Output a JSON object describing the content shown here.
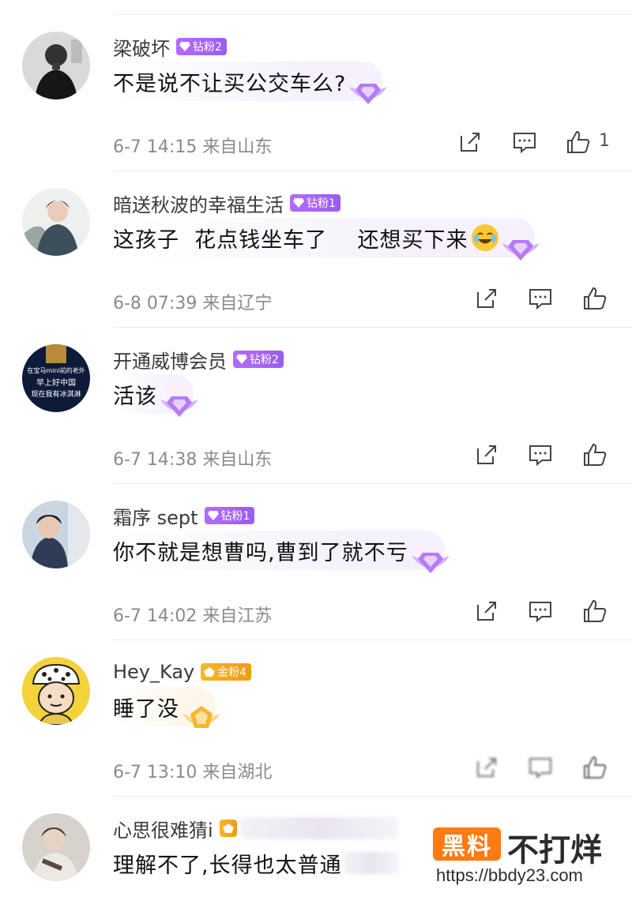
{
  "comments": [
    {
      "username": "梁破坏",
      "badge": {
        "label": "钻粉2",
        "type": "diamond"
      },
      "text": "不是说不让买公交车么?",
      "has_emoji": false,
      "time": "6-7 14:15",
      "location": "来自山东",
      "likes": "1"
    },
    {
      "username": "暗送秋波的幸福生活",
      "badge": {
        "label": "钻粉1",
        "type": "diamond"
      },
      "text": "这孩子  花点钱坐车了    还想买下来",
      "has_emoji": true,
      "emoji_name": "laughing-crying-emoji",
      "time": "6-8 07:39",
      "location": "来自辽宁",
      "likes": ""
    },
    {
      "username": "开通威博会员",
      "badge": {
        "label": "钻粉2",
        "type": "diamond"
      },
      "text": "活该",
      "has_emoji": false,
      "avatar_text": [
        "在宝马mini前的老外",
        "早上好中国",
        "现在我有冰淇淋"
      ],
      "time": "6-7 14:38",
      "location": "来自山东",
      "likes": ""
    },
    {
      "username": "霜序 sept",
      "badge": {
        "label": "钻粉1",
        "type": "diamond"
      },
      "text": "你不就是想曹吗,曹到了就不亏",
      "has_emoji": false,
      "time": "6-7 14:02",
      "location": "来自江苏",
      "likes": ""
    },
    {
      "username": "Hey_Kay",
      "badge": {
        "label": "金粉4",
        "type": "gold"
      },
      "text": "睡了没",
      "has_emoji": false,
      "time": "6-7 13:10",
      "location": "来自湖北",
      "likes": ""
    },
    {
      "username": "心思很难猜i",
      "badge": {
        "label": "",
        "type": "gold"
      },
      "text": "理解不了,长得也太普通",
      "has_emoji": false,
      "time": "",
      "location": "",
      "likes": ""
    }
  ],
  "watermark": {
    "box_text": "黑料",
    "title": "不打烊",
    "url": "https://bbdy23.com"
  },
  "colors": {
    "diamond_badge": "#a865f6",
    "gold_badge": "#f5a81f",
    "meta_text": "#8a8a8a",
    "watermark_box": "#ff7a12"
  },
  "icons": [
    "share-icon",
    "comment-icon",
    "like-icon"
  ]
}
